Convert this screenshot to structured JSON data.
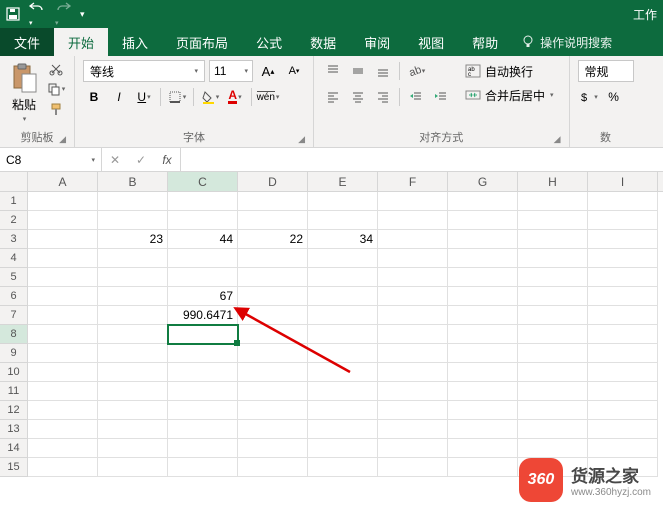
{
  "title_fragment": "工作",
  "tabs": {
    "file": "文件",
    "home": "开始",
    "insert": "插入",
    "layout": "页面布局",
    "formulas": "公式",
    "data": "数据",
    "review": "审阅",
    "view": "视图",
    "help": "帮助"
  },
  "tell_me": "操作说明搜索",
  "ribbon": {
    "paste": "粘贴",
    "clipboard": "剪贴板",
    "font_name": "等线",
    "font_size": "11",
    "font_group": "字体",
    "wrap": "自动换行",
    "merge": "合并后居中",
    "align_group": "对齐方式",
    "number_format": "常规",
    "number_group_prefix": "数"
  },
  "name_box": "C8",
  "formula": "",
  "columns": [
    "A",
    "B",
    "C",
    "D",
    "E",
    "F",
    "G",
    "H",
    "I"
  ],
  "row_count": 15,
  "active_col_idx": 2,
  "active_row_idx": 7,
  "cells": {
    "r3": {
      "B": "23",
      "C": "44",
      "D": "22",
      "E": "34"
    },
    "r6": {
      "C": "67"
    },
    "r7": {
      "C": "990.6471"
    }
  },
  "watermark": {
    "badge": "360",
    "title": "货源之家",
    "url": "www.360hyzj.com"
  }
}
